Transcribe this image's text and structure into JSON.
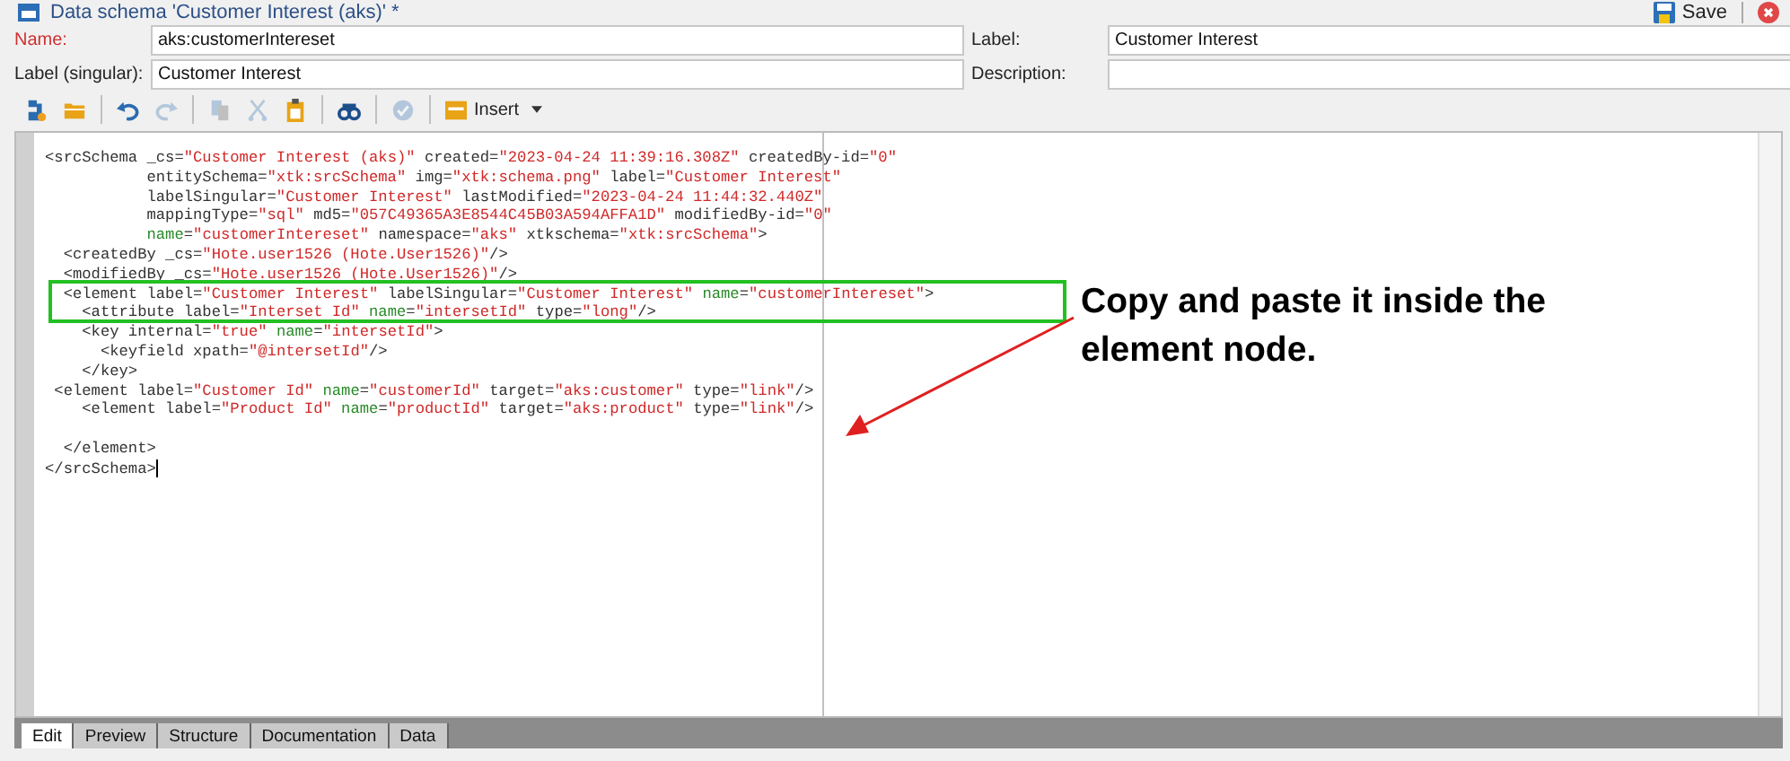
{
  "window": {
    "title": "Data schema 'Customer Interest (aks)' *",
    "save_label": "Save"
  },
  "fields": [
    {
      "label": "Name:",
      "value": "aks:customerIntereset",
      "required": true
    },
    {
      "label": "Label:",
      "value": "Customer Interest",
      "required": false
    },
    {
      "label": "Label (singular):",
      "value": "Customer Interest",
      "required": false
    },
    {
      "label": "Description:",
      "required": false
    }
  ],
  "toolbar": [
    {
      "kind": "new",
      "disabled": false
    },
    {
      "kind": "open",
      "disabled": false
    },
    {
      "kind": "sep"
    },
    {
      "kind": "undo",
      "disabled": false
    },
    {
      "kind": "redo",
      "disabled": true
    },
    {
      "kind": "sep"
    },
    {
      "kind": "copy",
      "disabled": true
    },
    {
      "kind": "cut",
      "disabled": true
    },
    {
      "kind": "paste",
      "disabled": false
    },
    {
      "kind": "sep"
    },
    {
      "kind": "find",
      "disabled": false
    },
    {
      "kind": "sep"
    },
    {
      "kind": "check",
      "disabled": true
    },
    {
      "kind": "sep"
    },
    {
      "kind": "insert",
      "label": "Insert",
      "disabled": false
    }
  ],
  "code_lines": [
    {
      "tokens": [
        {
          "kind": "plain",
          "text": "<srcSchema _cs="
        },
        {
          "kind": "value",
          "text": "\"Customer Interest (aks)\""
        },
        {
          "kind": "plain",
          "text": " created="
        },
        {
          "kind": "value",
          "text": "\"2023-04-24 11:39:16.308Z\""
        },
        {
          "kind": "plain",
          "text": " createdBy-id="
        },
        {
          "kind": "value",
          "text": "\"0\""
        }
      ]
    },
    {
      "continuation": true,
      "tokens": [
        {
          "kind": "plain",
          "text": "entitySchema="
        },
        {
          "kind": "value",
          "text": "\"xtk:srcSchema\""
        },
        {
          "kind": "plain",
          "text": " img="
        },
        {
          "kind": "value",
          "text": "\"xtk:schema.png\""
        },
        {
          "kind": "plain",
          "text": " label="
        },
        {
          "kind": "value",
          "text": "\"Customer Interest\""
        }
      ]
    },
    {
      "continuation": true,
      "tokens": [
        {
          "kind": "plain",
          "text": "labelSingular="
        },
        {
          "kind": "value",
          "text": "\"Customer Interest\""
        },
        {
          "kind": "plain",
          "text": " lastModified="
        },
        {
          "kind": "value",
          "text": "\"2023-04-24 11:44:32.440Z\""
        }
      ]
    },
    {
      "continuation": true,
      "tokens": [
        {
          "kind": "plain",
          "text": "mappingType="
        },
        {
          "kind": "value",
          "text": "\"sql\""
        },
        {
          "kind": "plain",
          "text": " md5="
        },
        {
          "kind": "value",
          "text": "\"057C49365A3E8544C45B03A594AFFA1D\""
        },
        {
          "kind": "plain",
          "text": " modifiedBy-id="
        },
        {
          "kind": "value",
          "text": "\"0\""
        }
      ]
    },
    {
      "continuation": true,
      "tokens": [
        {
          "kind": "attr",
          "text": "name"
        },
        {
          "kind": "plain",
          "text": "="
        },
        {
          "kind": "value",
          "text": "\"customerIntereset\""
        },
        {
          "kind": "plain",
          "text": " namespace="
        },
        {
          "kind": "value",
          "text": "\"aks\""
        },
        {
          "kind": "plain",
          "text": " xtkschema="
        },
        {
          "kind": "value",
          "text": "\"xtk:srcSchema\""
        },
        {
          "kind": "plain",
          "text": ">"
        }
      ]
    },
    {
      "tokens": [
        {
          "kind": "plain",
          "text": "  <createdBy _cs="
        },
        {
          "kind": "value",
          "text": "\"Hote.user1526 (Hote.User1526)\""
        },
        {
          "kind": "plain",
          "text": "/>"
        }
      ]
    },
    {
      "tokens": [
        {
          "kind": "plain",
          "text": "  <modifiedBy _cs="
        },
        {
          "kind": "value",
          "text": "\"Hote.user1526 (Hote.User1526)\""
        },
        {
          "kind": "plain",
          "text": "/>"
        }
      ]
    },
    {
      "tokens": [
        {
          "kind": "plain",
          "text": "  <element label="
        },
        {
          "kind": "value",
          "text": "\"Customer Interest\""
        },
        {
          "kind": "plain",
          "text": " labelSingular="
        },
        {
          "kind": "value",
          "text": "\"Customer Interest\""
        },
        {
          "kind": "attr",
          "text": " name"
        },
        {
          "kind": "plain",
          "text": "="
        },
        {
          "kind": "value",
          "text": "\"customerIntereset\""
        },
        {
          "kind": "plain",
          "text": ">"
        }
      ]
    },
    {
      "tokens": [
        {
          "kind": "plain",
          "text": "    <attribute label="
        },
        {
          "kind": "value",
          "text": "\"Interset Id\""
        },
        {
          "kind": "attr",
          "text": " name"
        },
        {
          "kind": "plain",
          "text": "="
        },
        {
          "kind": "value",
          "text": "\"intersetId\""
        },
        {
          "kind": "plain",
          "text": " type="
        },
        {
          "kind": "value",
          "text": "\"long\""
        },
        {
          "kind": "plain",
          "text": "/>"
        }
      ]
    },
    {
      "tokens": [
        {
          "kind": "plain",
          "text": "    <key internal="
        },
        {
          "kind": "value",
          "text": "\"true\""
        },
        {
          "kind": "attr",
          "text": " name"
        },
        {
          "kind": "plain",
          "text": "="
        },
        {
          "kind": "value",
          "text": "\"intersetId\""
        },
        {
          "kind": "plain",
          "text": ">"
        }
      ]
    },
    {
      "tokens": [
        {
          "kind": "plain",
          "text": "      <keyfield xpath="
        },
        {
          "kind": "value",
          "text": "\"@intersetId\""
        },
        {
          "kind": "plain",
          "text": "/>"
        }
      ]
    },
    {
      "tokens": [
        {
          "kind": "plain",
          "text": "    </key>"
        }
      ]
    },
    {
      "tokens": [
        {
          "kind": "plain",
          "text": " <element label="
        },
        {
          "kind": "value",
          "text": "\"Customer Id\""
        },
        {
          "kind": "attr",
          "text": " name"
        },
        {
          "kind": "plain",
          "text": "="
        },
        {
          "kind": "value",
          "text": "\"customerId\""
        },
        {
          "kind": "plain",
          "text": " target="
        },
        {
          "kind": "value",
          "text": "\"aks:customer\""
        },
        {
          "kind": "plain",
          "text": " type="
        },
        {
          "kind": "value",
          "text": "\"link\""
        },
        {
          "kind": "plain",
          "text": "/>"
        }
      ]
    },
    {
      "tokens": [
        {
          "kind": "plain",
          "text": "    <element label="
        },
        {
          "kind": "value",
          "text": "\"Product Id\""
        },
        {
          "kind": "attr",
          "text": " name"
        },
        {
          "kind": "plain",
          "text": "="
        },
        {
          "kind": "value",
          "text": "\"productId\""
        },
        {
          "kind": "plain",
          "text": " target="
        },
        {
          "kind": "value",
          "text": "\"aks:product\""
        },
        {
          "kind": "plain",
          "text": " type="
        },
        {
          "kind": "value",
          "text": "\"link\""
        },
        {
          "kind": "plain",
          "text": "/>"
        }
      ]
    },
    {
      "blank_before": true,
      "tokens": [
        {
          "kind": "plain",
          "text": "  </element>"
        }
      ]
    },
    {
      "cursor": true,
      "tokens": [
        {
          "kind": "plain",
          "text": "</srcSchema>"
        }
      ]
    }
  ],
  "annotation": {
    "text": "Copy and paste it inside the element node."
  },
  "tabs": [
    {
      "label": "Edit",
      "selected": true
    },
    {
      "label": "Preview",
      "selected": false
    },
    {
      "label": "Structure",
      "selected": false
    },
    {
      "label": "Documentation",
      "selected": false
    },
    {
      "label": "Data",
      "selected": false
    }
  ]
}
